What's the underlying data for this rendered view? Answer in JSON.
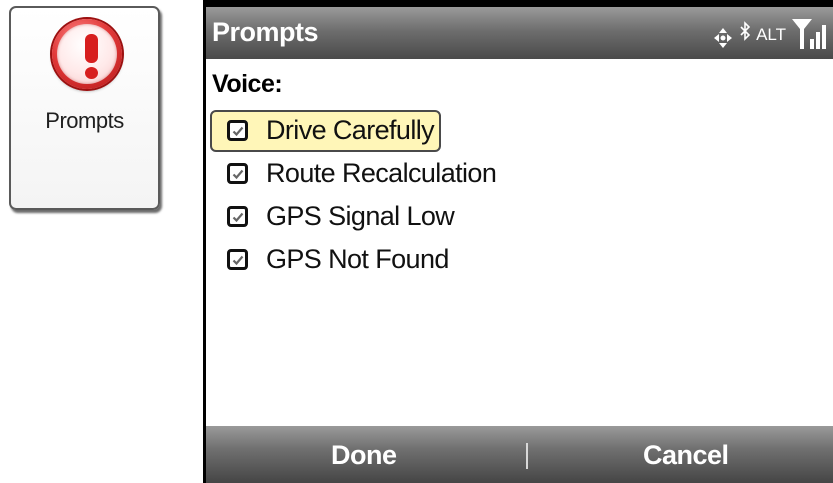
{
  "tile": {
    "label": "Prompts",
    "icon": "exclamation-icon"
  },
  "title_bar": {
    "title": "Prompts",
    "status": {
      "connectivity_icon": "connectivity-arrows-icon",
      "bluetooth_icon": "bluetooth-icon",
      "alt_label": "ALT",
      "signal_icon": "signal-strength-icon"
    }
  },
  "content": {
    "section_label": "Voice:",
    "options": [
      {
        "label": "Drive Carefully",
        "checked": true,
        "focused": true
      },
      {
        "label": "Route Recalculation",
        "checked": true,
        "focused": false
      },
      {
        "label": "GPS Signal Low",
        "checked": true,
        "focused": false
      },
      {
        "label": "GPS Not Found",
        "checked": true,
        "focused": false
      }
    ]
  },
  "softkeys": {
    "left": "Done",
    "right": "Cancel"
  },
  "colors": {
    "bar_top": "#9a9a9a",
    "bar_bottom": "#454545",
    "focus_fill": "#fff6b8",
    "icon_red": "#d71e1e"
  }
}
